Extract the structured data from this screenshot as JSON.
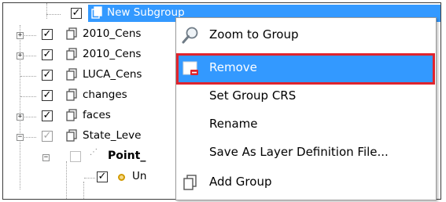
{
  "tree": {
    "rows": [
      {
        "label": "New Subgroup",
        "checked": true,
        "selected": true
      },
      {
        "label": "2010_Cens",
        "checked": true,
        "expander": "+"
      },
      {
        "label": "2010_Cens",
        "checked": true,
        "expander": "+"
      },
      {
        "label": "LUCA_Cens",
        "checked": true
      },
      {
        "label": "changes",
        "checked": true
      },
      {
        "label": "faces",
        "checked": true,
        "expander": "+"
      },
      {
        "label": "State_Leve",
        "checked": true,
        "expander": "−"
      },
      {
        "label": "Point_",
        "checked": false,
        "expander": "−"
      },
      {
        "label": "Un",
        "checked": true
      }
    ]
  },
  "context_menu": {
    "items": [
      {
        "label": "Zoom to Group",
        "icon": "zoom-icon"
      },
      {
        "label": "Remove",
        "icon": "remove-icon",
        "highlighted": true
      },
      {
        "label": "Set Group CRS"
      },
      {
        "label": "Rename"
      },
      {
        "label": "Save As Layer Definition File..."
      },
      {
        "label": "Add Group",
        "icon": "add-group-icon"
      }
    ]
  },
  "colors": {
    "selection": "#3399ff",
    "highlight_outline": "#e0242d"
  }
}
